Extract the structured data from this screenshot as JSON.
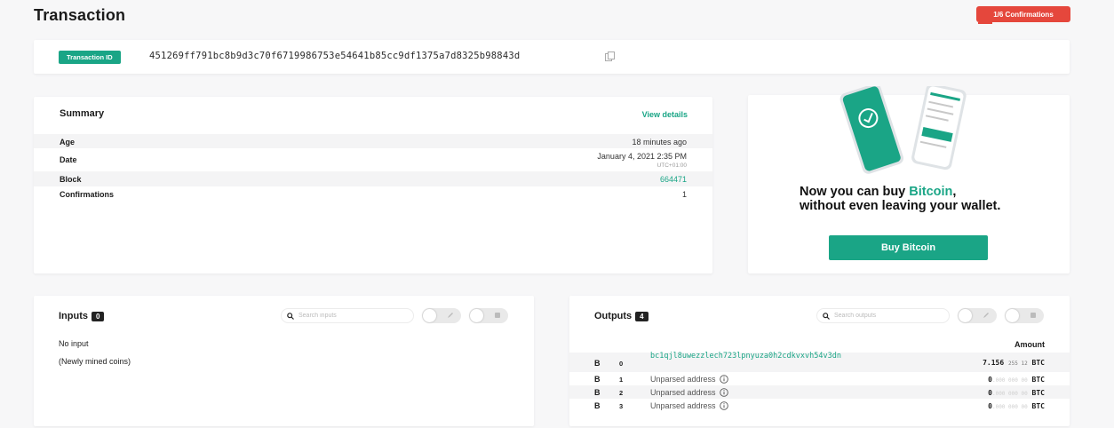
{
  "page": {
    "title": "Transaction",
    "confirmations_badge": "1/6 Confirmations"
  },
  "txid": {
    "label": "Transaction ID",
    "value": "451269ff791bc8b9d3c70f6719986753e54641b85cc9df1375a7d8325b98843d"
  },
  "summary": {
    "title": "Summary",
    "view_details": "View details",
    "rows": [
      {
        "label": "Age",
        "value": "18 minutes ago"
      },
      {
        "label": "Date",
        "value": "January 4, 2021 2:35 PM",
        "sub": "UTC+01:00"
      },
      {
        "label": "Block",
        "value": "664471"
      },
      {
        "label": "Confirmations",
        "value": "1"
      }
    ]
  },
  "promo": {
    "line_a": "Now you can buy ",
    "highlight": "Bitcoin",
    "line_b": ",",
    "line_c": "without even leaving your wallet.",
    "button": "Buy Bitcoin"
  },
  "inputs": {
    "title": "Inputs",
    "count": "0",
    "search_placeholder": "Search inputs",
    "no_input": "No input",
    "mined": "(Newly mined coins)"
  },
  "outputs": {
    "title": "Outputs",
    "count": "4",
    "search_placeholder": "Search outputs",
    "amount_header": "Amount",
    "rows": [
      {
        "symbol": "B",
        "index": "0",
        "address": "bc1qjl8uwezzlech723lpnyuza0h2cdkvxvh54v3dn",
        "amount_main": "7.156",
        "amount_small": "255 12",
        "unit": "BTC"
      },
      {
        "symbol": "B",
        "index": "1",
        "address": "Unparsed address",
        "amount_main": "0",
        "amount_small": ".000 000 00",
        "unit": "BTC"
      },
      {
        "symbol": "B",
        "index": "2",
        "address": "Unparsed address",
        "amount_main": "0",
        "amount_small": ".000 000 00",
        "unit": "BTC"
      },
      {
        "symbol": "B",
        "index": "3",
        "address": "Unparsed address",
        "amount_main": "0",
        "amount_small": ".000 000 00",
        "unit": "BTC"
      }
    ]
  },
  "colors": {
    "accent": "#1aa586",
    "badge_red": "#e5473c"
  },
  "icons": [
    "copy-icon",
    "search-icon",
    "info-icon",
    "edit-icon",
    "toggle-icon",
    "check-circle-icon"
  ]
}
